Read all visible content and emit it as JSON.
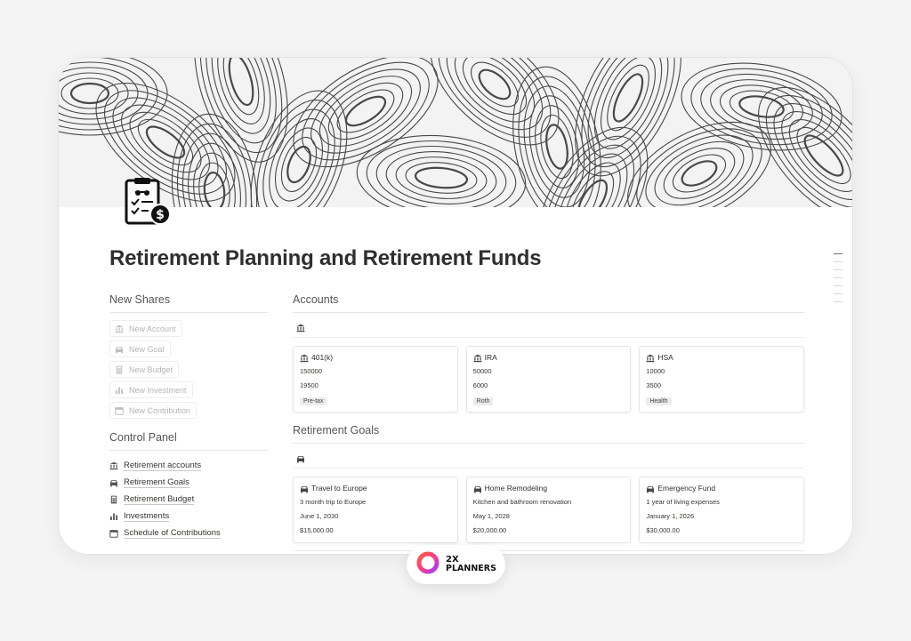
{
  "page": {
    "title": "Retirement Planning and Retirement Funds"
  },
  "sidebar": {
    "new_heading": "New Shares",
    "new_buttons": [
      {
        "label": "New Account",
        "icon": "bank-icon"
      },
      {
        "label": "New Goal",
        "icon": "car-icon"
      },
      {
        "label": "New Budget",
        "icon": "calculator-icon"
      },
      {
        "label": "New Investment",
        "icon": "bar-chart-icon"
      },
      {
        "label": "New Contribution",
        "icon": "calendar-icon"
      }
    ],
    "control_heading": "Control Panel",
    "control_links": [
      {
        "label": "Retirement accounts",
        "icon": "bank-icon"
      },
      {
        "label": "Retirement Goals",
        "icon": "car-icon"
      },
      {
        "label": "Retirement Budget",
        "icon": "calculator-icon"
      },
      {
        "label": "Investments",
        "icon": "bar-chart-icon"
      },
      {
        "label": "Schedule of Contributions",
        "icon": "calendar-icon"
      }
    ]
  },
  "accounts": {
    "heading": "Accounts",
    "view_icon": "bank-icon",
    "cards": [
      {
        "name": "401(k)",
        "balance": "150000",
        "contribution": "19500",
        "tag": "Pre-tax"
      },
      {
        "name": "IRA",
        "balance": "50000",
        "contribution": "6000",
        "tag": "Roth"
      },
      {
        "name": "HSA",
        "balance": "10000",
        "contribution": "3500",
        "tag": "Health"
      }
    ]
  },
  "goals": {
    "heading": "Retirement Goals",
    "view_icon": "car-icon",
    "cards": [
      {
        "name": "Travel to Europe",
        "description": "3 month trip to Europe",
        "date": "June 1, 2030",
        "amount": "$15,000.00"
      },
      {
        "name": "Home Remodeling",
        "description": "Kitchen and bathroom renovation",
        "date": "May 1, 2028",
        "amount": "$20,000.00"
      },
      {
        "name": "Emergency Fund",
        "description": "1 year of living expenses",
        "date": "January 1, 2026",
        "amount": "$30,000.00"
      }
    ]
  },
  "brand": {
    "line1": "2X",
    "line2": "PLANNERS"
  },
  "colors": {
    "accent_gradient": [
      "#ff5a3c",
      "#b03cff"
    ],
    "text": "#37352f"
  }
}
